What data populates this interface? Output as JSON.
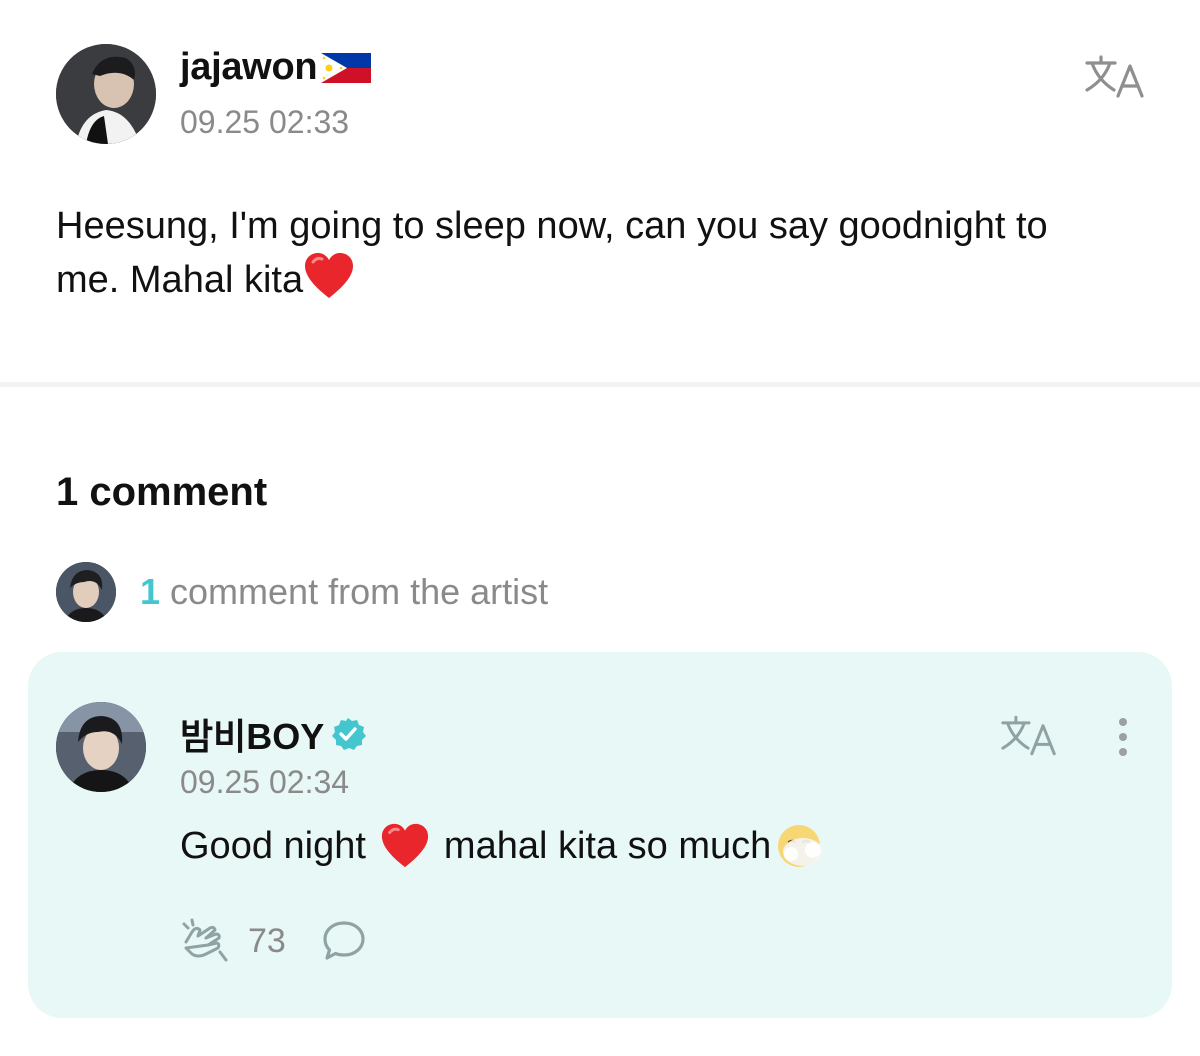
{
  "post": {
    "author_name": "jajawon",
    "timestamp": "09.25 02:33",
    "body_line1": "Heesung, I'm going to sleep now, can you say goodnight to",
    "body_line2": "me. Mahal kita",
    "author_flag_icon": "philippines-flag-icon",
    "translate_icon": "translate-icon"
  },
  "comments": {
    "count_label": "1 comment",
    "artist_summary_count": "1",
    "artist_summary_text": " comment from the artist",
    "items": [
      {
        "author_name": "밤비BOY",
        "verified_icon": "verified-badge-icon",
        "timestamp": "09.25 02:34",
        "text_part1": "Good night",
        "text_part2": "mahal kita so much",
        "like_count": "73",
        "like_icon": "like-hands-icon",
        "reply_icon": "reply-bubble-icon",
        "more_icon": "more-vertical-icon"
      }
    ]
  },
  "colors": {
    "accent": "#45c6cf",
    "card_background": "#e7f8f6",
    "muted_text": "#8a8a8a",
    "heart": "#e8262c"
  }
}
